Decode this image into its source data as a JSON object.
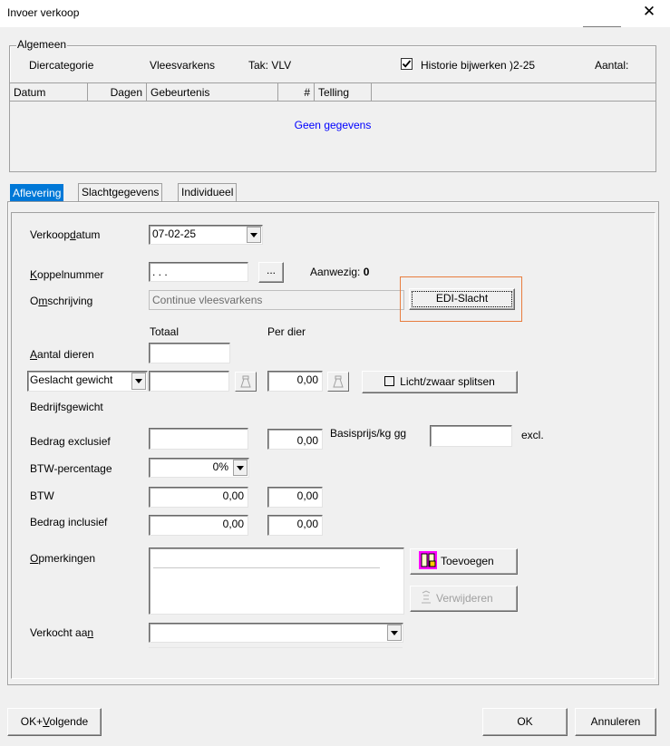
{
  "window": {
    "title": "Invoer verkoop",
    "close_icon": "close-icon"
  },
  "algemeen": {
    "legend": "Algemeen",
    "diercategorie_label": "Diercategorie",
    "diercategorie_value": "Vleesvarkens",
    "tak": "Tak: VLV",
    "historie_label": "Historie bijwerken ",
    "historie_date": ")2-25",
    "historie_checked": true,
    "aantal_label": "Aantal:",
    "columns": [
      "Datum",
      "Dagen",
      "Gebeurtenis",
      "#",
      "Telling"
    ],
    "empty_text": "Geen gegevens"
  },
  "tabs": [
    "Aflevering",
    "Slachtgegevens",
    "Individueel"
  ],
  "form": {
    "verkoopdatum_label_pre": "Verkoop",
    "verkoopdatum_label_u": "d",
    "verkoopdatum_label_post": "atum",
    "verkoopdatum_value": "07-02-25",
    "koppelnummer_label_u": "K",
    "koppelnummer_label_post": "oppelnummer",
    "koppelnummer_value": ". . .",
    "koppelnummer_browse": "...",
    "aanwezig_label": "Aanwezig:",
    "aanwezig_value": "0",
    "omschrijving_label_pre": "O",
    "omschrijving_label_u": "m",
    "omschrijving_label_post": "schrijving",
    "omschrijving_value": "Continue vleesvarkens",
    "edi_slacht": "EDI-Slacht",
    "totaal_header": "Totaal",
    "per_dier_header": "Per dier",
    "aantal_dieren_label_u": "A",
    "aantal_dieren_label_post": "antal dieren",
    "gewicht_select": "Geslacht gewicht",
    "per_dier_gewicht": "0,00",
    "licht_zwaar": "Licht/zwaar splitsen",
    "bedrijfsgewicht_label": "Bedrijfsgewicht",
    "bedrag_excl_label": "Bedrag exclusief",
    "bedrag_excl_per_dier": "0,00",
    "basisprijs_label_pre": "Basisprijs/kg ",
    "basisprijs_label_u": "g",
    "basisprijs_label_post": "g",
    "excl_label": "excl.",
    "btw_pct_label": "BTW-percentage",
    "btw_pct_value": "0%",
    "btw_label": "BTW",
    "btw_totaal": "0,00",
    "btw_per_dier": "0,00",
    "bedrag_incl_label": "Bedrag inclusief",
    "bedrag_incl_totaal": "0,00",
    "bedrag_incl_per_dier": "0,00",
    "opmerkingen_label_u": "O",
    "opmerkingen_label_post": "pmerkingen",
    "toevoegen": "Toevoegen",
    "verwijderen": "Verwijderen",
    "verkocht_aan_label_pre": "Verkocht aa",
    "verkocht_aan_label_u": "n"
  },
  "footer": {
    "ok_volgende_pre": "OK+",
    "ok_volgende_u": "V",
    "ok_volgende_post": "olgende",
    "ok": "OK",
    "annuleren": "Annuleren"
  },
  "colors": {
    "tab_active_bg": "#0078d7",
    "empty_text": "#0000ff",
    "highlight_border": "#e87d3e",
    "toevoegen_icon": "#ff00ff"
  }
}
